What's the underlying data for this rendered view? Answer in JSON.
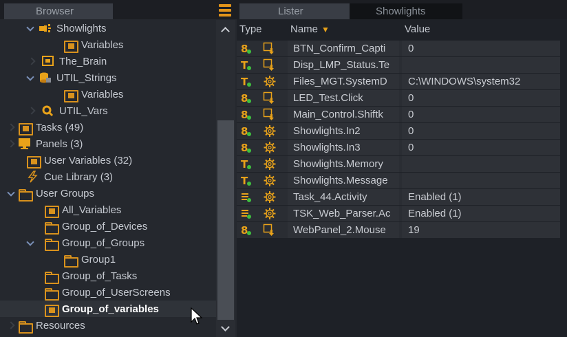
{
  "browser": {
    "tab_label": "Browser",
    "tree": [
      {
        "label": "Showlights",
        "icon": "showlights-icon",
        "expanded": true,
        "depth": 1
      },
      {
        "label": "Variables",
        "icon": "variables-folder-icon",
        "depth": 2
      },
      {
        "label": "The_Brain",
        "icon": "brain-icon",
        "expanded": false,
        "depth": 1
      },
      {
        "label": "UTIL_Strings",
        "icon": "database-icon",
        "expanded": true,
        "depth": 1
      },
      {
        "label": "Variables",
        "icon": "variables-folder-icon",
        "depth": 2
      },
      {
        "label": "UTIL_Vars",
        "icon": "magnifier-icon",
        "expanded": false,
        "depth": 1
      },
      {
        "label": "Tasks (49)",
        "icon": "variables-folder-icon",
        "expanded": false,
        "depth": 0
      },
      {
        "label": "Panels (3)",
        "icon": "monitor-icon",
        "expanded": false,
        "depth": 0
      },
      {
        "label": "User Variables (32)",
        "icon": "variables-folder-icon",
        "depth": 0
      },
      {
        "label": "Cue Library (3)",
        "icon": "lightning-icon",
        "depth": 0
      },
      {
        "label": "User Groups",
        "icon": "folder-icon",
        "expanded": true,
        "depth": 0
      },
      {
        "label": "All_Variables",
        "icon": "variables-folder-icon",
        "depth": 1
      },
      {
        "label": "Group_of_Devices",
        "icon": "folder-icon",
        "depth": 1
      },
      {
        "label": "Group_of_Groups",
        "icon": "folder-icon",
        "expanded": true,
        "depth": 1
      },
      {
        "label": "Group1",
        "icon": "folder-icon",
        "depth": 2
      },
      {
        "label": "Group_of_Tasks",
        "icon": "folder-icon",
        "depth": 1
      },
      {
        "label": "Group_of_UserScreens",
        "icon": "folder-icon",
        "depth": 1
      },
      {
        "label": "Group_of_variables",
        "icon": "variables-folder-icon",
        "depth": 1,
        "selected": true
      },
      {
        "label": "Resources",
        "icon": "folder-icon",
        "expanded": false,
        "depth": 0
      }
    ]
  },
  "lister": {
    "tabs": [
      {
        "label": "Lister",
        "active": true
      },
      {
        "label": "Showlights",
        "active": false
      }
    ],
    "columns": {
      "type": "Type",
      "name": "Name",
      "value": "Value"
    },
    "sort_column": "Name",
    "rows": [
      {
        "type": "numeric",
        "source": "device",
        "name": "BTN_Confirm_Capti",
        "value": "0"
      },
      {
        "type": "text",
        "source": "device",
        "name": "Disp_LMP_Status.Te",
        "value": ""
      },
      {
        "type": "text",
        "source": "system",
        "name": "Files_MGT.SystemD",
        "value": "C:\\WINDOWS\\system32"
      },
      {
        "type": "numeric",
        "source": "device",
        "name": "LED_Test.Click",
        "value": "0"
      },
      {
        "type": "numeric",
        "source": "device",
        "name": "Main_Control.Shiftk",
        "value": "0"
      },
      {
        "type": "numeric",
        "source": "system",
        "name": "Showlights.In2",
        "value": "0"
      },
      {
        "type": "numeric",
        "source": "system",
        "name": "Showlights.In3",
        "value": "0"
      },
      {
        "type": "text",
        "source": "system",
        "name": "Showlights.Memory",
        "value": ""
      },
      {
        "type": "text",
        "source": "system",
        "name": "Showlights.Message",
        "value": ""
      },
      {
        "type": "enum",
        "source": "system",
        "name": "Task_44.Activity",
        "value": "Enabled (1)"
      },
      {
        "type": "enum",
        "source": "system",
        "name": "TSK_Web_Parser.Ac",
        "value": "Enabled (1)"
      },
      {
        "type": "numeric",
        "source": "device",
        "name": "WebPanel_2.Mouse",
        "value": "19"
      }
    ]
  },
  "colors": {
    "accent": "#e8a21a",
    "folder": "#d9921d",
    "background": "#1e2127",
    "row": "#2e3137"
  }
}
